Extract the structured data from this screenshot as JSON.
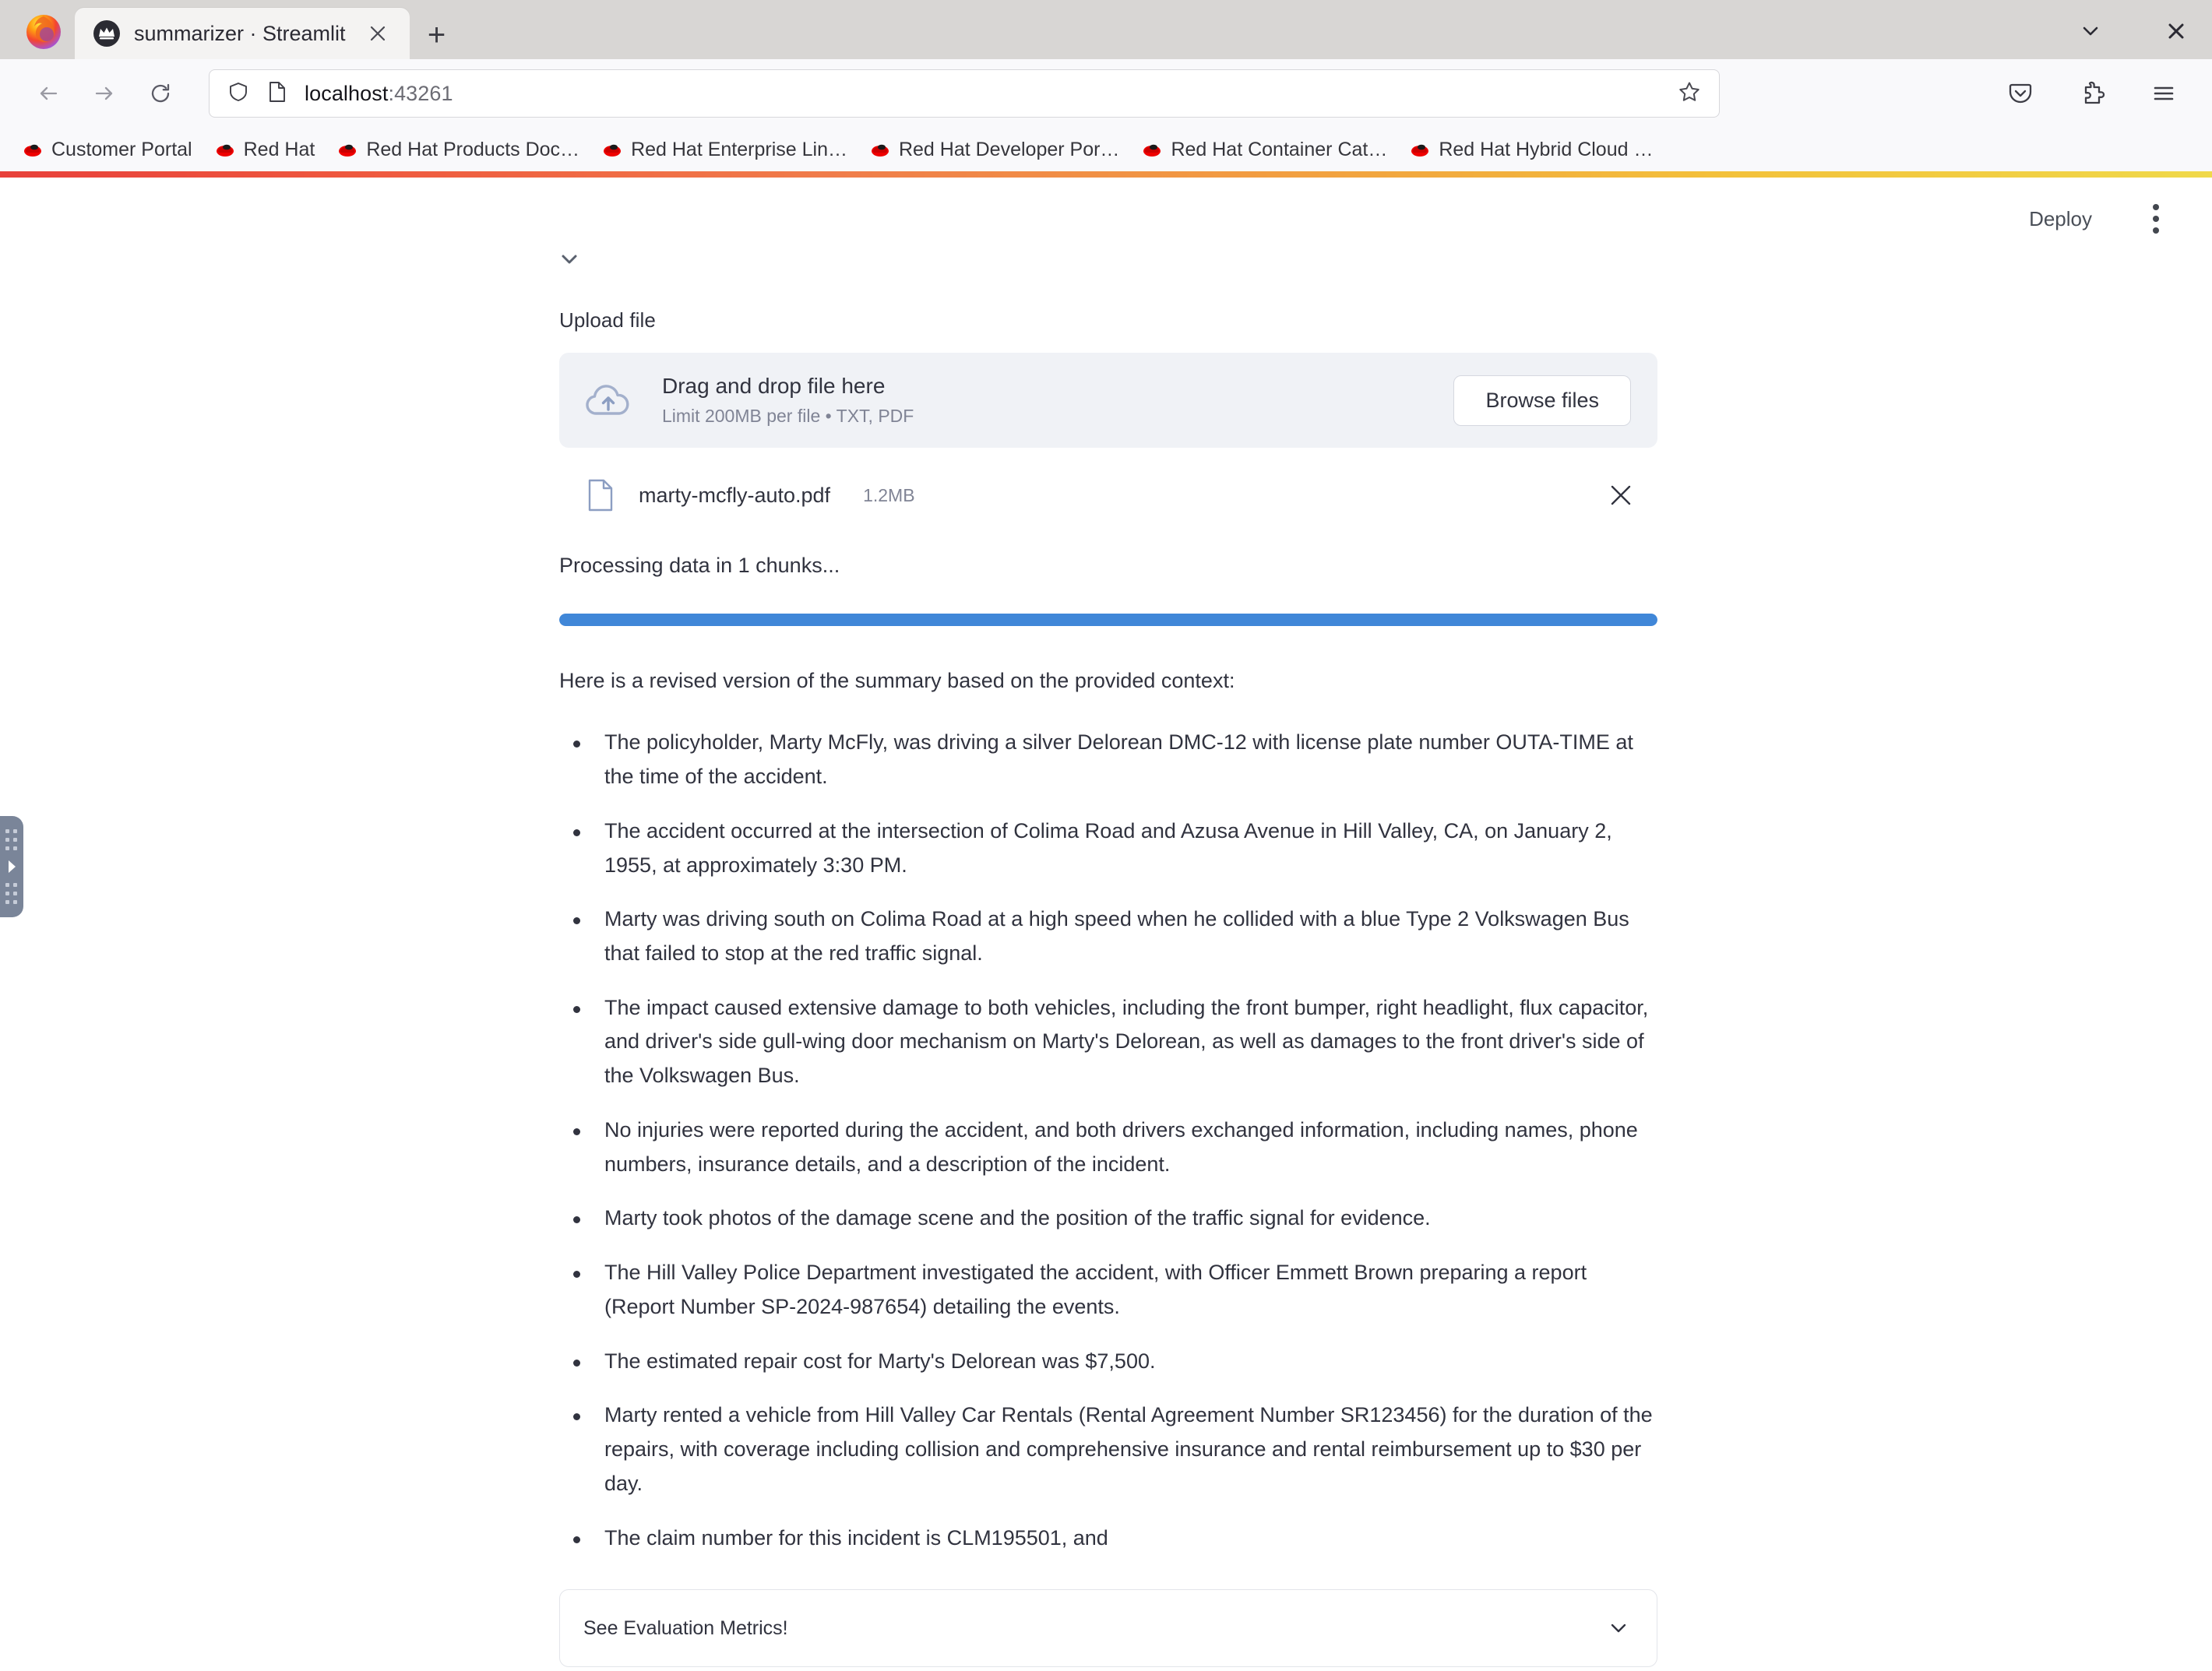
{
  "browser": {
    "tab": {
      "title": "summarizer · Streamlit",
      "favicon_icon": "streamlit-crown-icon",
      "close_icon": "close-icon"
    },
    "new_tab_label": "+",
    "window_controls": {
      "list_all_tabs_icon": "chevron-down-icon",
      "close_window_icon": "close-icon"
    },
    "nav": {
      "back_icon": "arrow-left-icon",
      "forward_icon": "arrow-right-icon",
      "reload_icon": "reload-icon"
    },
    "url": {
      "host": "localhost",
      "port": ":43261",
      "shield_icon": "shield-icon",
      "page_icon": "page-icon",
      "bookmark_star_icon": "star-icon"
    },
    "toolbar_right": [
      {
        "name": "pocket-icon",
        "label": "Save to Pocket"
      },
      {
        "name": "extensions-icon",
        "label": "Extensions"
      },
      {
        "name": "menu-icon",
        "label": "Open application menu"
      }
    ],
    "bookmarks": [
      {
        "label": "Customer Portal",
        "icon": "redhat-icon"
      },
      {
        "label": "Red Hat",
        "icon": "redhat-icon"
      },
      {
        "label": "Red Hat Products Doc…",
        "icon": "redhat-icon"
      },
      {
        "label": "Red Hat Enterprise Lin…",
        "icon": "redhat-icon"
      },
      {
        "label": "Red Hat Developer Por…",
        "icon": "redhat-icon"
      },
      {
        "label": "Red Hat Container Cat…",
        "icon": "redhat-icon"
      },
      {
        "label": "Red Hat Hybrid Cloud …",
        "icon": "redhat-icon"
      }
    ]
  },
  "app": {
    "header": {
      "deploy_label": "Deploy",
      "menu_icon": "kebab-menu-icon"
    },
    "sidebar_handle_icon": "expand-sidebar-icon",
    "upload": {
      "label": "Upload file",
      "dropzone_title": "Drag and drop file here",
      "dropzone_subtitle": "Limit 200MB per file • TXT, PDF",
      "browse_label": "Browse files",
      "cloud_icon": "cloud-upload-icon"
    },
    "uploaded_file": {
      "name": "marty-mcfly-auto.pdf",
      "size": "1.2MB",
      "file_icon": "file-icon",
      "remove_icon": "close-icon"
    },
    "status": "Processing data in 1 chunks...",
    "progress": {
      "percent": 100,
      "color": "#4087d8"
    },
    "summary": {
      "intro": "Here is a revised version of the summary based on the provided context:",
      "bullets": [
        "The policyholder, Marty McFly, was driving a silver Delorean DMC-12 with license plate number OUTA-TIME at the time of the accident.",
        "The accident occurred at the intersection of Colima Road and Azusa Avenue in Hill Valley, CA, on January 2, 1955, at approximately 3:30 PM.",
        "Marty was driving south on Colima Road at a high speed when he collided with a blue Type 2 Volkswagen Bus that failed to stop at the red traffic signal.",
        "The impact caused extensive damage to both vehicles, including the front bumper, right headlight, flux capacitor, and driver's side gull-wing door mechanism on Marty's Delorean, as well as damages to the front driver's side of the Volkswagen Bus.",
        "No injuries were reported during the accident, and both drivers exchanged information, including names, phone numbers, insurance details, and a description of the incident.",
        "Marty took photos of the damage scene and the position of the traffic signal for evidence.",
        "The Hill Valley Police Department investigated the accident, with Officer Emmett Brown preparing a report (Report Number SP-2024-987654) detailing the events.",
        "The estimated repair cost for Marty's Delorean was $7,500.",
        "Marty rented a vehicle from Hill Valley Car Rentals (Rental Agreement Number SR123456) for the duration of the repairs, with coverage including collision and comprehensive insurance and rental reimbursement up to $30 per day.",
        "The claim number for this incident is CLM195501, and"
      ]
    },
    "expander": {
      "label": "See Evaluation Metrics!",
      "chevron_icon": "chevron-down-icon"
    }
  }
}
